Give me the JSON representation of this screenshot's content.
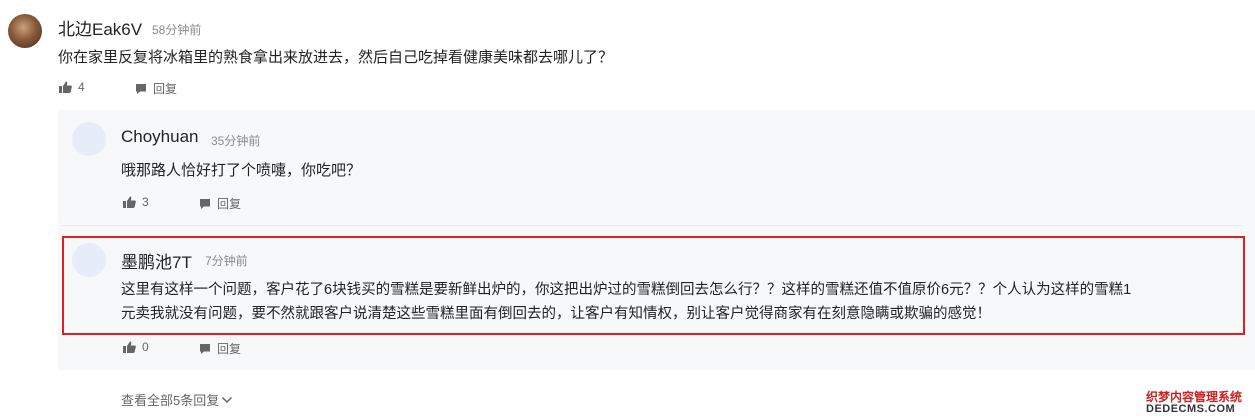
{
  "comment": {
    "author": "北边Eak6V",
    "time": "58分钟前",
    "text": "你在家里反复将冰箱里的熟食拿出来放进去，然后自己吃掉看健康美味都去哪儿了？",
    "likes": "4",
    "reply_label": "回复"
  },
  "replies": [
    {
      "author": "Choyhuan",
      "time": "35分钟前",
      "text_lines": [
        "哦那路人恰好打了个喷嚏，你吃吧？"
      ],
      "likes": "3",
      "reply_label": "回复"
    },
    {
      "author": "墨鹏池7T",
      "time": "7分钟前",
      "text_lines": [
        "这里有这样一个问题，客户花了6块钱买的雪糕是要新鲜出炉的，你这把出炉过的雪糕倒回去怎么行？？这样的雪糕还值不值原价6元？？个人认为这样的雪糕1",
        "元卖我就没有问题，要不然就跟客户说清楚这些雪糕里面有倒回去的，让客户有知情权，别让客户觉得商家有在刻意隐瞒或欺骗的感觉！"
      ],
      "likes": "0",
      "reply_label": "回复"
    }
  ],
  "view_all": "查看全部5条回复",
  "watermark": {
    "line1": "织梦内容管理系统",
    "line2": "DEDECMS.COM"
  },
  "colors": {
    "highlight": "#e02020",
    "reply_bg": "#f7f8fa",
    "avatar_default": "#e6edf8"
  },
  "icons": {
    "like": "thumbs-up-icon",
    "reply": "comment-bubble-icon",
    "expand": "chevron-down-icon"
  }
}
